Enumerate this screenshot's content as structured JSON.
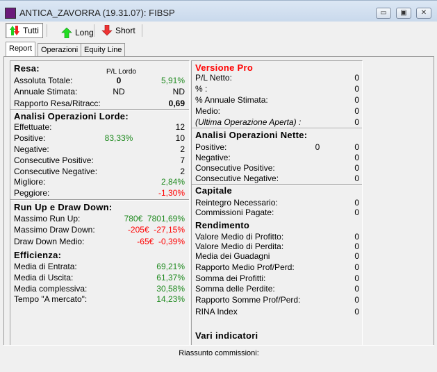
{
  "window": {
    "title": "ANTICA_ZAVORRA (19.31.07): FIBSP",
    "minimize": "▭",
    "maximize": "▣",
    "close": "✕"
  },
  "toolbar": {
    "tutti": "Tutti",
    "long": "Long",
    "short": "Short"
  },
  "tabs": [
    "Report",
    "Operazioni",
    "Equity Line"
  ],
  "colors": {
    "positive": "#1f8a1f",
    "negative": "#ff0000",
    "pro_header": "#ff0000"
  },
  "left": {
    "pl_lordo_label": "P/L Lordo",
    "rows": [
      {
        "t": "h",
        "label": "Resa:"
      },
      {
        "label": "Assoluta Totale:",
        "mid": "0",
        "value": "5,91%",
        "vc": "g",
        "midb": true
      },
      {
        "label": "Annuale Stimata:",
        "mid": "ND",
        "value": "ND"
      },
      {
        "label": "Rapporto Resa/Ritracc:",
        "value": "0,69",
        "vb": true
      },
      {
        "t": "d"
      },
      {
        "t": "h",
        "label": "Analisi Operazioni Lorde:"
      },
      {
        "label": "Effettuate:",
        "value": "12"
      },
      {
        "label": "Positive:",
        "mid": "83,33%",
        "mc": "g",
        "value": "10"
      },
      {
        "label": "Negative:",
        "value": "2"
      },
      {
        "label": "Consecutive Positive:",
        "value": "7"
      },
      {
        "label": "Consecutive Negative:",
        "value": "2"
      },
      {
        "label": "Migliore:",
        "value": "2,84%",
        "vc": "g"
      },
      {
        "label": "Peggiore:",
        "value": "-1,30%",
        "vc": "red"
      },
      {
        "t": "d"
      },
      {
        "t": "h",
        "label": "Run Up e Draw Down:"
      },
      {
        "label": "Massimo Run Up:",
        "value": "780€  7801,69%",
        "vc": "g"
      },
      {
        "label": "Massimo Draw Down:",
        "value": "-205€  -27,15%",
        "vc": "red"
      },
      {
        "label": "Draw Down Medio:",
        "value": "-65€  -0,39%",
        "vc": "red"
      },
      {
        "t": "h",
        "label": "Efficienza:"
      },
      {
        "label": "Media di Entrata:",
        "value": "69,21%",
        "vc": "g"
      },
      {
        "label": "Media di Uscita:",
        "value": "61,37%",
        "vc": "g"
      },
      {
        "label": "Media complessiva:",
        "value": "30,58%",
        "vc": "g"
      },
      {
        "label": "Tempo \"A mercato\":",
        "value": "14,23%",
        "vc": "g"
      }
    ]
  },
  "right": {
    "rows": [
      {
        "t": "h",
        "label": "Versione Pro",
        "lc": "red"
      },
      {
        "label": "P/L Netto:",
        "value": "0"
      },
      {
        "label": "% :",
        "value": "0"
      },
      {
        "label": "% Annuale Stimata:",
        "value": "0"
      },
      {
        "label": "Medio:",
        "value": "0"
      },
      {
        "label": "(Ultima Operazione Aperta) :",
        "value": "0",
        "italic": true
      },
      {
        "t": "d"
      },
      {
        "t": "h",
        "label": "Analisi Operazioni Nette:"
      },
      {
        "label": "Positive:",
        "mid": "0",
        "value": "0"
      },
      {
        "label": "Negative:",
        "value": "0"
      },
      {
        "label": "Consecutive Positive:",
        "value": "0"
      },
      {
        "label": "Consecutive Negative:",
        "value": "0"
      },
      {
        "t": "d"
      },
      {
        "t": "h",
        "label": "Capitale"
      },
      {
        "label": "Reintegro Necessario:",
        "value": "0"
      },
      {
        "label": "Commissioni Pagate:",
        "value": "0"
      },
      {
        "t": "h",
        "label": "Rendimento"
      },
      {
        "label": "Valore Medio di Profitto:",
        "value": "0"
      },
      {
        "label": "Valore Medio di Perdita:",
        "value": "0"
      },
      {
        "label": "Media dei Guadagni",
        "value": "0"
      },
      {
        "label": "Rapporto Medio Prof/Perd:",
        "value": "0"
      },
      {
        "label": "Somma dei Profitti:",
        "value": "0"
      },
      {
        "label": "Somma delle Perdite:",
        "value": "0"
      },
      {
        "label": "Rapporto Somme Prof/Perd:",
        "value": "0"
      },
      {
        "label": "RINA Index",
        "value": "0"
      },
      {
        "t": "h",
        "label": "Vari indicatori"
      }
    ]
  },
  "status": {
    "label": "Riassunto commissioni:"
  }
}
